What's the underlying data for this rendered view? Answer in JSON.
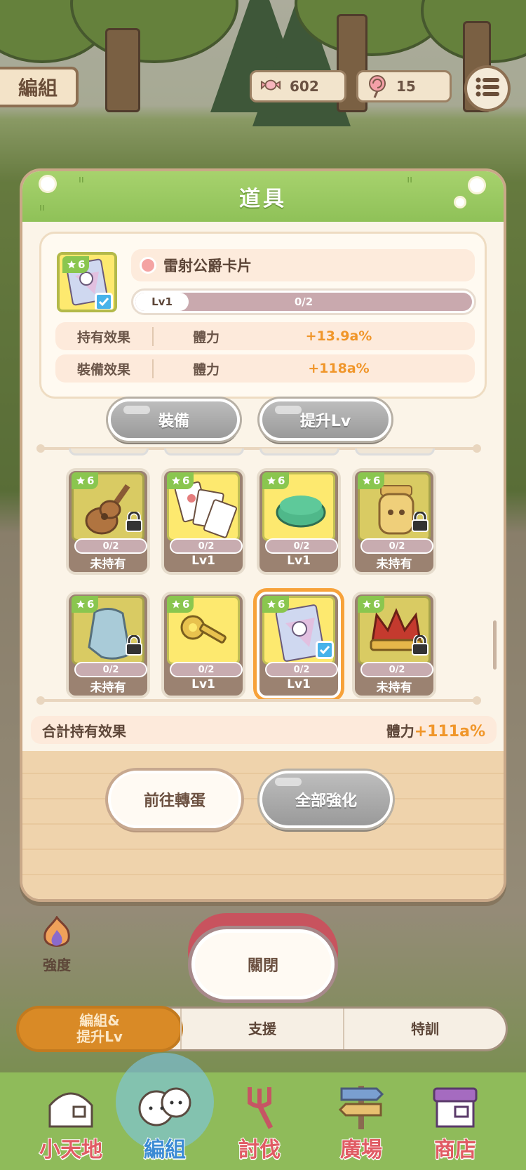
{
  "topbar": {
    "team_sign": "編組",
    "candy": "602",
    "lollipop": "15"
  },
  "dialog": {
    "title": "道具",
    "selected": {
      "stars": "6",
      "name": "雷射公爵卡片",
      "level": "Lv1",
      "progress": "0/2",
      "progress_fraction": 0
    },
    "effects": [
      {
        "label": "持有效果",
        "stat": "體力",
        "value": "+13.9a%"
      },
      {
        "label": "裝備效果",
        "stat": "體力",
        "value": "+118a%"
      }
    ],
    "equip_button": "裝備",
    "upgrade_button": "提升Lv",
    "items": [
      {
        "icon": "guitar-icon",
        "stars": "6",
        "count": "0/2",
        "status": "未持有",
        "locked": true
      },
      {
        "icon": "cards-icon",
        "stars": "6",
        "count": "0/2",
        "status": "Lv1",
        "locked": false
      },
      {
        "icon": "hat-icon",
        "stars": "6",
        "count": "0/2",
        "status": "Lv1",
        "locked": false
      },
      {
        "icon": "jar-icon",
        "stars": "6",
        "count": "0/2",
        "status": "未持有",
        "locked": true
      },
      {
        "icon": "cloth-icon",
        "stars": "6",
        "count": "0/2",
        "status": "未持有",
        "locked": true
      },
      {
        "icon": "key-icon",
        "stars": "6",
        "count": "0/2",
        "status": "Lv1",
        "locked": false
      },
      {
        "icon": "laser-card-icon",
        "stars": "6",
        "count": "0/2",
        "status": "Lv1",
        "locked": false,
        "selected": true
      },
      {
        "icon": "crown-icon",
        "stars": "6",
        "count": "0/2",
        "status": "未持有",
        "locked": true
      }
    ],
    "total": {
      "label": "合計持有效果",
      "stat": "體力",
      "value": "+111a%"
    },
    "gacha_button": "前往轉蛋",
    "enhance_all_button": "全部強化"
  },
  "bottom": {
    "strength_label": "強度",
    "close_button": "關閉",
    "tabs": [
      "編組&\n提升Lv",
      "支援",
      "特訓"
    ],
    "nav": [
      "小天地",
      "編組",
      "討伐",
      "廣場",
      "商店"
    ]
  },
  "colors": {
    "accent": "#f0962a",
    "header_green": "#8fc158",
    "active_tab": "#d98a26"
  }
}
